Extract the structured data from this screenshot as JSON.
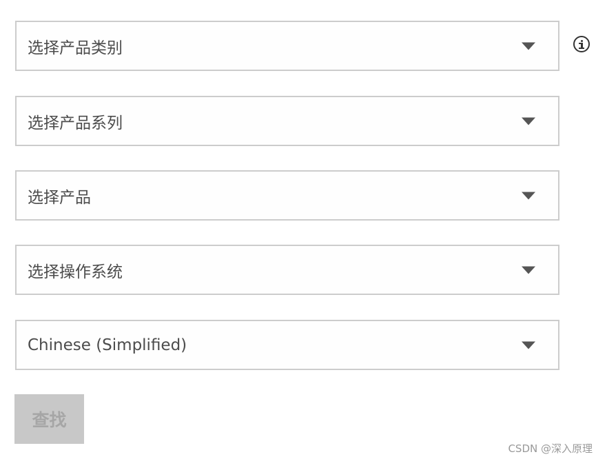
{
  "dropdowns": [
    {
      "value": "选择产品类别"
    },
    {
      "value": "选择产品系列"
    },
    {
      "value": "选择产品"
    },
    {
      "value": "选择操作系统"
    },
    {
      "value": "Chinese (Simplified)"
    }
  ],
  "info_icon": "info-circle-icon",
  "search_button": {
    "label": "查找",
    "disabled": true
  },
  "watermark": "CSDN @深入原理",
  "colors": {
    "border": "#cccccc",
    "text": "#4c4c4c",
    "arrow": "#555555",
    "button_bg": "#c8c8c8",
    "button_text": "#a6a6a6"
  }
}
